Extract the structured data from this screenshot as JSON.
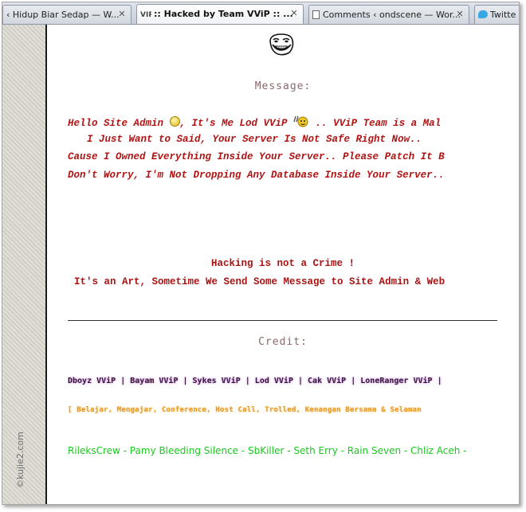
{
  "tabs": [
    {
      "label": "‹ Hidup Biar Sedap — W...",
      "favicon": "",
      "active": false
    },
    {
      "label": ":: Hacked by Team VViP :: ...",
      "favicon": "VIP",
      "active": true
    },
    {
      "label": "Comments ‹ ondscene — Wor...",
      "favicon": "document-icon",
      "active": false
    },
    {
      "label": "Twitte",
      "favicon": "twitter-icon",
      "active": false
    }
  ],
  "tab_close_glyph": "✕",
  "watermark": "©kujie2.com",
  "page": {
    "message_heading": "Message:",
    "message_lines": {
      "line1_part1": "Hello Site Admin ",
      "line1_part2": ", It's Me Lod VViP ",
      "line1_part3": " .. VViP Team is a Mal",
      "line2": "I Just Want to Said, Your Server Is Not Safe Right Now..",
      "line3": "Cause I Owned Everything Inside Your Server.. Please Patch It B",
      "line4": "Don't Worry, I'm Not Dropping Any Database Inside Your Server.."
    },
    "quote_line1": "Hacking is not a Crime !",
    "quote_line2": "It's an Art, Sometime We Send Some Message to Site Admin & Web",
    "credit_heading": "Credit:",
    "credit_names": "Dboyz VViP | Bayam VViP | Sykes VViP | Lod VViP | Cak VViP | LoneRanger VViP | ",
    "credit_orange": "[ Belajar, Mengajar, Conference, Host Call, Trolled, Kenangan Bersama & Selaman",
    "credit_green": "RileksCrew - Pamy Bleeding Silence - SbKiller - Seth Erry - Rain Seven - Chliz Aceh - "
  },
  "colors": {
    "message_red": "#b01414",
    "heading_gray": "#8a6a6a",
    "credit_green": "#19c81e",
    "credit_orange": "#e89a26"
  }
}
